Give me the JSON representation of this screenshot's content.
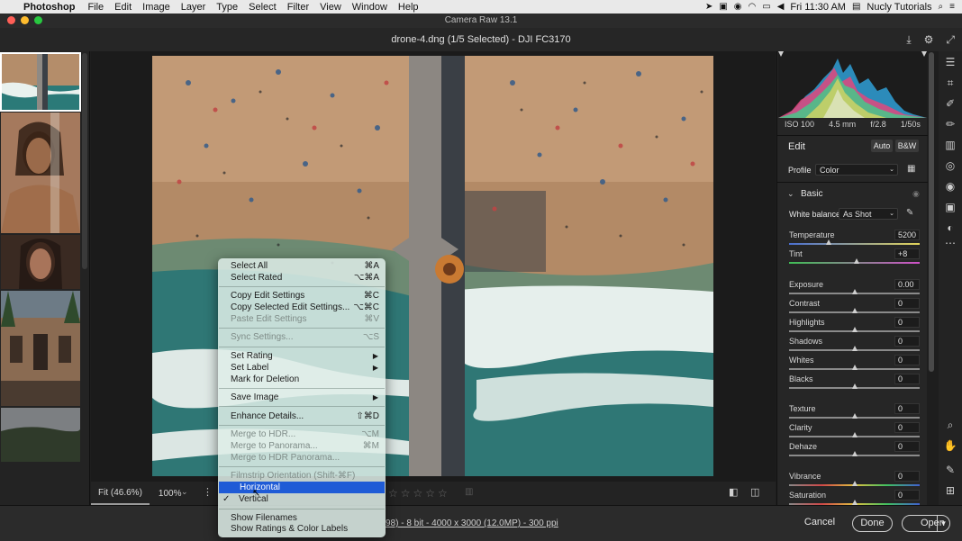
{
  "menubar": {
    "app_name": "Photoshop",
    "items": [
      "File",
      "Edit",
      "Image",
      "Layer",
      "Type",
      "Select",
      "Filter",
      "View",
      "Window",
      "Help"
    ],
    "clock": "Fri 11:30 AM",
    "user": "Nucly Tutorials"
  },
  "window": {
    "title": "Camera Raw 13.1",
    "file_info": "drone-4.dng (1/5 Selected)  -  DJI FC3170"
  },
  "canvas": {
    "fit_label": "Fit (46.6%)",
    "zoom_label": "100%",
    "image_info": "98) - 8 bit - 4000 x 3000 (12.0MP) - 300 ppi"
  },
  "footer": {
    "cancel": "Cancel",
    "done": "Done",
    "open": "Open"
  },
  "exif": {
    "iso": "ISO 100",
    "focal": "4.5 mm",
    "aperture": "f/2.8",
    "shutter": "1/50s"
  },
  "edit_panel": {
    "title": "Edit",
    "auto": "Auto",
    "bw": "B&W",
    "profile_label": "Profile",
    "profile_value": "Color",
    "basic_label": "Basic",
    "wb_label": "White balance",
    "wb_value": "As Shot",
    "sliders": [
      {
        "label": "Temperature",
        "value": "5200",
        "pos": 0.3
      },
      {
        "label": "Tint",
        "value": "+8",
        "pos": 0.52
      },
      {
        "label": "Exposure",
        "value": "0.00",
        "pos": 0.5
      },
      {
        "label": "Contrast",
        "value": "0",
        "pos": 0.5
      },
      {
        "label": "Highlights",
        "value": "0",
        "pos": 0.5
      },
      {
        "label": "Shadows",
        "value": "0",
        "pos": 0.5
      },
      {
        "label": "Whites",
        "value": "0",
        "pos": 0.5
      },
      {
        "label": "Blacks",
        "value": "0",
        "pos": 0.5
      },
      {
        "label": "Texture",
        "value": "0",
        "pos": 0.5
      },
      {
        "label": "Clarity",
        "value": "0",
        "pos": 0.5
      },
      {
        "label": "Dehaze",
        "value": "0",
        "pos": 0.5
      },
      {
        "label": "Vibrance",
        "value": "0",
        "pos": 0.5
      },
      {
        "label": "Saturation",
        "value": "0",
        "pos": 0.5
      }
    ]
  },
  "context_menu": {
    "select_all": {
      "label": "Select All",
      "shortcut": "⌘A"
    },
    "select_rated": {
      "label": "Select Rated",
      "shortcut": "⌥⌘A"
    },
    "copy_edit": {
      "label": "Copy Edit Settings",
      "shortcut": "⌘C"
    },
    "copy_selected": {
      "label": "Copy Selected Edit Settings...",
      "shortcut": "⌥⌘C"
    },
    "paste_edit": {
      "label": "Paste Edit Settings",
      "shortcut": "⌘V"
    },
    "sync": {
      "label": "Sync Settings...",
      "shortcut": "⌥S"
    },
    "set_rating": {
      "label": "Set Rating"
    },
    "set_label": {
      "label": "Set Label"
    },
    "mark_deletion": {
      "label": "Mark for Deletion"
    },
    "save_image": {
      "label": "Save Image"
    },
    "enhance": {
      "label": "Enhance Details...",
      "shortcut": "⇧⌘D"
    },
    "merge_hdr": {
      "label": "Merge to HDR...",
      "shortcut": "⌥M"
    },
    "merge_pano": {
      "label": "Merge to Panorama...",
      "shortcut": "⌘M"
    },
    "merge_hdr_pano": {
      "label": "Merge to HDR Panorama..."
    },
    "orientation_header": {
      "label": "Filmstrip Orientation (Shift-⌘F)"
    },
    "horizontal": {
      "label": "Horizontal"
    },
    "vertical": {
      "label": "Vertical"
    },
    "show_filenames": {
      "label": "Show Filenames"
    },
    "show_ratings": {
      "label": "Show Ratings & Color Labels"
    }
  }
}
